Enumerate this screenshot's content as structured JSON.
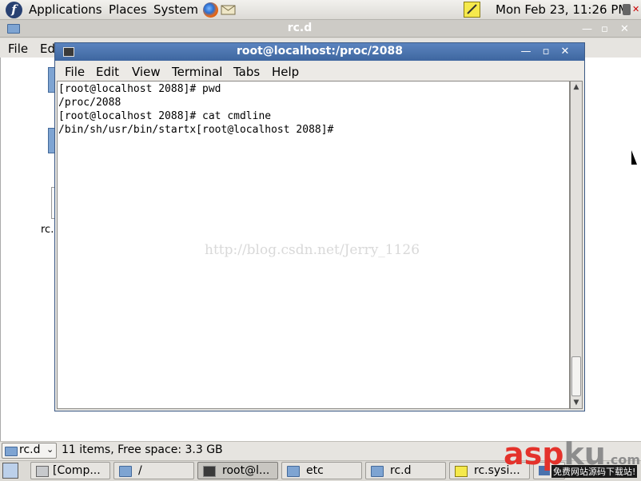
{
  "top_panel": {
    "menus": [
      "Applications",
      "Places",
      "System"
    ],
    "clock": "Mon Feb 23, 11:26 PM"
  },
  "nautilus": {
    "title": "rc.d",
    "menus": [
      "File",
      "Edi"
    ],
    "desktop_label": "rc.",
    "location": "rc.d",
    "status": "11 items, Free space: 3.3 GB"
  },
  "terminal": {
    "title": "root@localhost:/proc/2088",
    "menus": [
      "File",
      "Edit",
      "View",
      "Terminal",
      "Tabs",
      "Help"
    ],
    "output": "[root@localhost 2088]# pwd\n/proc/2088\n[root@localhost 2088]# cat cmdline\n/bin/sh/usr/bin/startx[root@localhost 2088]# ",
    "watermark": "http://blog.csdn.net/Jerry_1126"
  },
  "taskbar": {
    "tasks": [
      "[Comp...",
      "/",
      "root@l...",
      "etc",
      "rc.d",
      "rc.sysi..."
    ]
  },
  "overlay": {
    "logo_asp": "asp",
    "logo_ku": "ku",
    "logo_com": ".com",
    "logo_sub": "免费网站源码下载站!"
  },
  "colors": {
    "title_active": "#4a72ad",
    "logo_red": "#e4322b",
    "logo_gray": "#8d8d8d"
  }
}
